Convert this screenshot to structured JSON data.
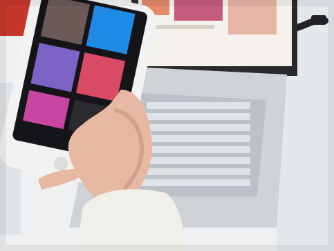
{
  "scene": {
    "description_free": true,
    "palette": {
      "desk_white": "#eef0f1",
      "desk_shadow": "#d7dadc",
      "laptop_silver": "#cfd3d8",
      "laptop_silver_dark": "#aab0b8",
      "laptop_screen_frame": "#2a2a2e",
      "laptop_screen_bg": "#f5f1ec",
      "phone_frame": "#f2f2f2",
      "phone_screen": "#151519",
      "skin": "#e7b9a3",
      "skin_shadow": "#c98e77",
      "sleeve": "#f1efe9",
      "red_object": "#c4382b",
      "cable": "#222326"
    },
    "phone_tiles": [
      {
        "color": "#6b5a57"
      },
      {
        "color": "#1e8be6"
      },
      {
        "color": "#7c63c6"
      },
      {
        "color": "#d94a64"
      },
      {
        "color": "#c746a2"
      },
      {
        "color": "#2a2a2e"
      }
    ],
    "laptop_screen_thumbs": [
      {
        "color": "#e28a6a"
      },
      {
        "color": "#c45c7d"
      },
      {
        "color": "#e7b5a6"
      }
    ]
  }
}
